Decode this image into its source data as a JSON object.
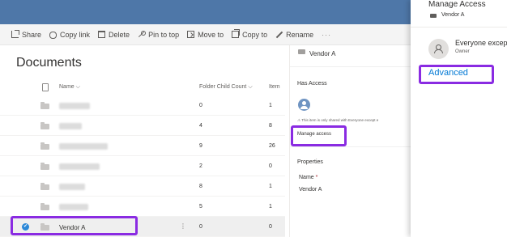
{
  "command_bar": {
    "share": "Share",
    "copy_link": "Copy link",
    "delete": "Delete",
    "pin_to_top": "Pin to top",
    "move_to": "Move to",
    "copy_to": "Copy to",
    "rename": "Rename",
    "more": "···"
  },
  "library": {
    "title": "Documents",
    "columns": {
      "name": "Name",
      "folder_child_count": "Folder Child Count",
      "item_count": "Item"
    },
    "rows": [
      {
        "count": "0",
        "items": "1"
      },
      {
        "count": "4",
        "items": "8"
      },
      {
        "count": "9",
        "items": "26"
      },
      {
        "count": "2",
        "items": "0"
      },
      {
        "count": "8",
        "items": "1"
      },
      {
        "count": "5",
        "items": "1"
      },
      {
        "name": "Vendor A",
        "count": "0",
        "items": "0",
        "selected": true
      }
    ]
  },
  "details_pane": {
    "folder_name": "Vendor A",
    "has_access_heading": "Has Access",
    "sharing_note": "This item is only shared with Everyone except e",
    "manage_access": "Manage access",
    "properties_heading": "Properties",
    "name_label": "Name",
    "required_marker": "*",
    "name_value": "Vendor A"
  },
  "manage_access_panel": {
    "title": "Manage Access",
    "folder_name": "Vendor A",
    "user_name": "Everyone excep",
    "user_role": "Owner",
    "advanced_link": "Advanced"
  },
  "colors": {
    "suite_bar": "#4e77a8",
    "highlight": "#8a2be2",
    "link": "#0078d4",
    "selected_check": "#2b88d8"
  }
}
